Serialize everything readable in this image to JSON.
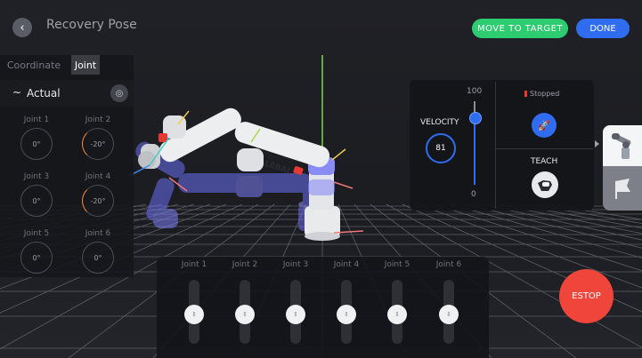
{
  "header": {
    "title": "Recovery Pose",
    "move_to_target_label": "MOVE TO TARGET",
    "done_label": "DONE"
  },
  "left_panel": {
    "tabs": [
      "Coordinate",
      "Joint"
    ],
    "active_tab": "Joint",
    "mode_label": "Actual",
    "joints": [
      {
        "label": "Joint 1",
        "value": "0°"
      },
      {
        "label": "Joint 2",
        "value": "-20°"
      },
      {
        "label": "Joint 3",
        "value": "0°"
      },
      {
        "label": "Joint 4",
        "value": "-20°"
      },
      {
        "label": "Joint 5",
        "value": "0°"
      },
      {
        "label": "Joint 6",
        "value": "0°"
      }
    ]
  },
  "velocity": {
    "label": "VELOCITY",
    "value": "81",
    "slider_max": "100",
    "slider_min": "0",
    "level_fraction": 0.81,
    "accent_color": "#2f6cf0"
  },
  "status": {
    "text": "Stopped",
    "color": "#e53935"
  },
  "teach": {
    "label": "TEACH"
  },
  "robot": {
    "brand": "LEBAI"
  },
  "jog_sliders": {
    "labels": [
      "Joint 1",
      "Joint 2",
      "Joint 3",
      "Joint 4",
      "Joint 5",
      "Joint 6"
    ]
  },
  "estop_label": "ESTOP",
  "icons": {
    "back": "chevron-left-icon",
    "mode": "waveform-icon",
    "locate": "target-icon",
    "rocket": "rocket-icon",
    "teach": "hand-icon",
    "robot_view": "robot-arm-icon",
    "flag_view": "flag-icon"
  }
}
